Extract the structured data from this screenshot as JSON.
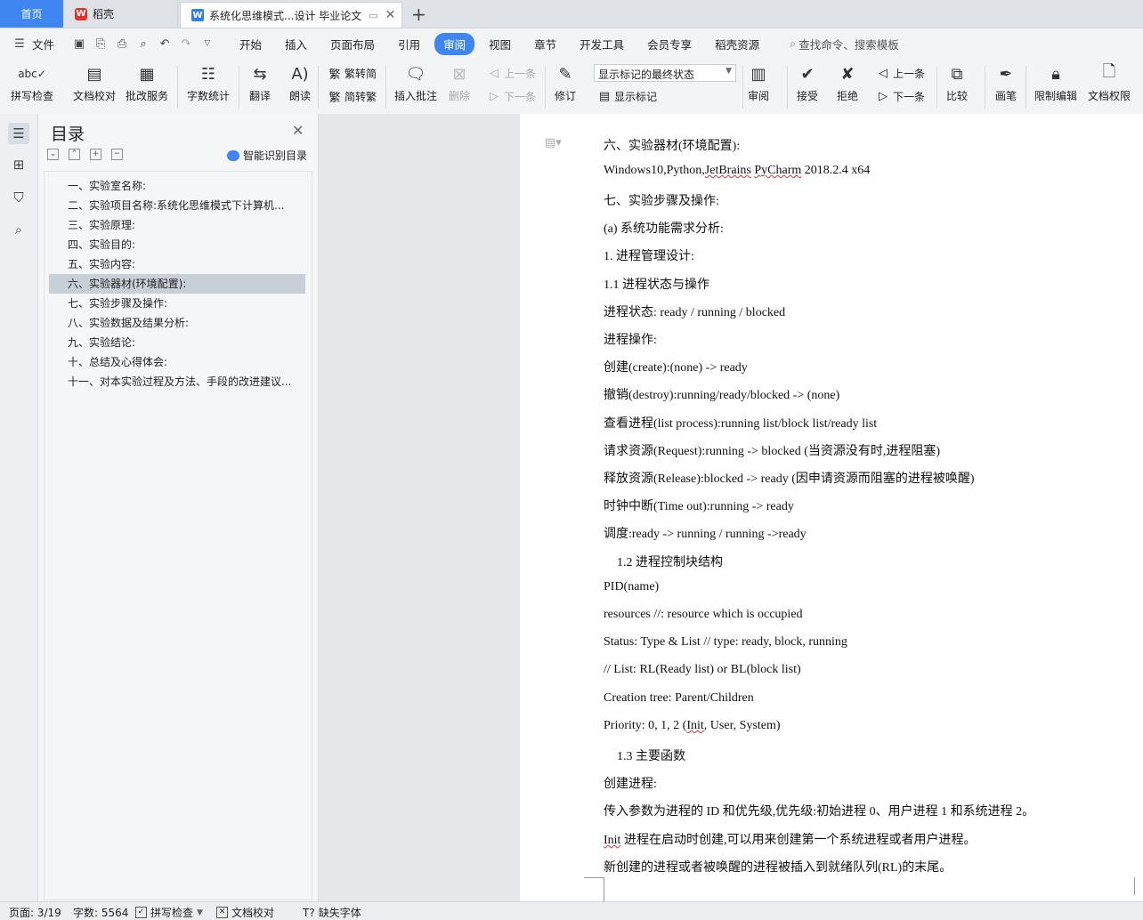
{
  "tabs": {
    "home": "首页",
    "wps": "稻壳",
    "doc": "系统化思维模式...设计 毕业论文"
  },
  "menu": [
    "文件",
    "开始",
    "插入",
    "页面布局",
    "引用",
    "审阅",
    "视图",
    "章节",
    "开发工具",
    "会员专享",
    "稻壳资源"
  ],
  "menu_active": "审阅",
  "search_placeholder": "查找命令、搜索模板",
  "ribbon": {
    "spell_check": "拼写检查",
    "doc_proof": "文档校对",
    "review_service": "批改服务",
    "word_count": "字数统计",
    "translate": "翻译",
    "read_aloud": "朗读",
    "trad_to_simp": "繁转简",
    "simp_to_trad": "简转繁",
    "insert_comment": "插入批注",
    "delete": "删除",
    "prev_comment": "上一条",
    "next_comment": "下一条",
    "track_changes": "修订",
    "markup_mode": "显示标记的最终状态",
    "show_markup": "显示标记",
    "review": "审阅",
    "accept": "接受",
    "reject": "拒绝",
    "prev_change": "上一条",
    "next_change": "下一条",
    "compare": "比较",
    "pen": "画笔",
    "restrict_edit": "限制编辑",
    "doc_permission": "文档权限"
  },
  "toc": {
    "title": "目录",
    "smart": "智能识别目录",
    "items": [
      "一、实验室名称:",
      "二、实验项目名称:系统化思维模式下计算机...",
      "三、实验原理:",
      "四、实验目的:",
      "五、实验内容:",
      "六、实验器材(环境配置):",
      "七、实验步骤及操作:",
      "八、实验数据及结果分析:",
      "九、实验结论:",
      "十、总结及心得体会:",
      "十一、对本实验过程及方法、手段的改进建议..."
    ],
    "active_index": 5
  },
  "document": {
    "lines": [
      {
        "t": "六、实验器材(环境配置):"
      },
      {
        "t": "Windows10,Python,JetBrains PyCharm 2018.2.4 x64"
      },
      {
        "t": "七、实验步骤及操作:"
      },
      {
        "t": "(a) 系统功能需求分析:"
      },
      {
        "t": "1. 进程管理设计:"
      },
      {
        "t": "1.1 进程状态与操作"
      },
      {
        "t": "进程状态: ready / running / blocked"
      },
      {
        "t": "进程操作:"
      },
      {
        "t": "创建(create):(none) -> ready"
      },
      {
        "t": "撤销(destroy):running/ready/blocked -> (none)"
      },
      {
        "t": "查看进程(list process):running list/block list/ready list"
      },
      {
        "t": "请求资源(Request):running -> blocked (当资源没有时,进程阻塞)"
      },
      {
        "t": "释放资源(Release):blocked -> ready (因申请资源而阻塞的进程被唤醒)"
      },
      {
        "t": "时钟中断(Time out):running -> ready"
      },
      {
        "t": "调度:ready -> running / running ->ready"
      },
      {
        "t": "1.2 进程控制块结构",
        "indent": true
      },
      {
        "t": "PID(name)"
      },
      {
        "t": "resources //: resource which is occupied"
      },
      {
        "t": "Status: Type & List // type: ready, block, running"
      },
      {
        "t": "// List: RL(Ready list) or BL(block list)"
      },
      {
        "t": "Creation tree: Parent/Children"
      },
      {
        "t": "Priority: 0, 1, 2 (Init, User, System)"
      },
      {
        "t": "1.3 主要函数",
        "indent": true
      },
      {
        "t": "创建进程:"
      },
      {
        "t": "传入参数为进程的 ID 和优先级,优先级:初始进程 0、用户进程 1 和系统进程 2。"
      },
      {
        "t": "Init 进程在启动时创建,可以用来创建第一个系统进程或者用户进程。"
      },
      {
        "t": "新创建的进程或者被唤醒的进程被插入到就绪队列(RL)的末尾。"
      }
    ]
  },
  "status": {
    "page": "页面: 3/19",
    "words": "字数: 5564",
    "spell": "拼写检查",
    "proof": "文档校对",
    "missing_font": "缺失字体"
  },
  "colors": {
    "accent": "#3f86f0",
    "wps_red": "#e2322d"
  }
}
